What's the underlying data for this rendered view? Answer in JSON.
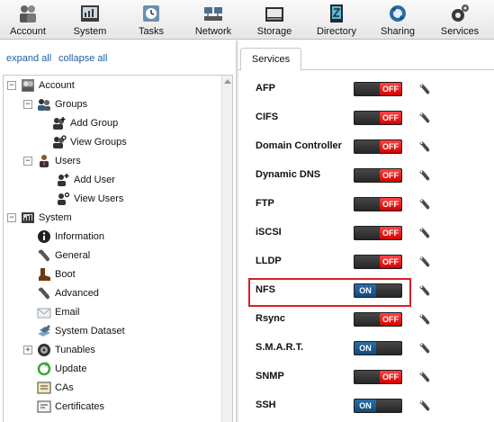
{
  "toolbar": {
    "items": [
      {
        "label": "Account",
        "icon": "account-icon"
      },
      {
        "label": "System",
        "icon": "system-icon"
      },
      {
        "label": "Tasks",
        "icon": "tasks-icon"
      },
      {
        "label": "Network",
        "icon": "network-icon"
      },
      {
        "label": "Storage",
        "icon": "storage-icon"
      },
      {
        "label": "Directory",
        "icon": "directory-icon"
      },
      {
        "label": "Sharing",
        "icon": "sharing-icon"
      },
      {
        "label": "Services",
        "icon": "services-icon"
      }
    ]
  },
  "left": {
    "expand_all": "expand all",
    "collapse_all": "collapse all",
    "tree": [
      {
        "label": "Account",
        "level": 0,
        "expander": "−",
        "icon": "account-group-icon"
      },
      {
        "label": "Groups",
        "level": 1,
        "expander": "−",
        "icon": "groups-icon"
      },
      {
        "label": "Add Group",
        "level": 2,
        "icon": "add-group-icon"
      },
      {
        "label": "View Groups",
        "level": 2,
        "icon": "view-groups-icon"
      },
      {
        "label": "Users",
        "level": 1,
        "expander": "−",
        "icon": "users-icon"
      },
      {
        "label": "Add User",
        "level": 2,
        "icon": "add-user-icon"
      },
      {
        "label": "View Users",
        "level": 2,
        "icon": "view-users-icon"
      },
      {
        "label": "System",
        "level": 0,
        "expander": "−",
        "icon": "system-icon"
      },
      {
        "label": "Information",
        "level": 1,
        "icon": "information-icon"
      },
      {
        "label": "General",
        "level": 1,
        "icon": "wrench-icon"
      },
      {
        "label": "Boot",
        "level": 1,
        "icon": "boot-icon"
      },
      {
        "label": "Advanced",
        "level": 1,
        "icon": "wrench-icon"
      },
      {
        "label": "Email",
        "level": 1,
        "icon": "email-icon"
      },
      {
        "label": "System Dataset",
        "level": 1,
        "icon": "system-dataset-icon"
      },
      {
        "label": "Tunables",
        "level": 1,
        "expander": "+",
        "icon": "tunables-icon"
      },
      {
        "label": "Update",
        "level": 1,
        "icon": "update-icon"
      },
      {
        "label": "CAs",
        "level": 1,
        "icon": "cas-icon"
      },
      {
        "label": "Certificates",
        "level": 1,
        "icon": "certificates-icon"
      }
    ]
  },
  "right": {
    "tab_label": "Services",
    "services": [
      {
        "name": "AFP",
        "state": "OFF"
      },
      {
        "name": "CIFS",
        "state": "OFF"
      },
      {
        "name": "Domain Controller",
        "state": "OFF"
      },
      {
        "name": "Dynamic DNS",
        "state": "OFF"
      },
      {
        "name": "FTP",
        "state": "OFF"
      },
      {
        "name": "iSCSI",
        "state": "OFF"
      },
      {
        "name": "LLDP",
        "state": "OFF"
      },
      {
        "name": "NFS",
        "state": "ON",
        "highlighted": true
      },
      {
        "name": "Rsync",
        "state": "OFF"
      },
      {
        "name": "S.M.A.R.T.",
        "state": "ON"
      },
      {
        "name": "SNMP",
        "state": "OFF"
      },
      {
        "name": "SSH",
        "state": "ON"
      }
    ]
  },
  "colors": {
    "on": "#14497a",
    "off": "#d40000",
    "highlight": "#d91f26",
    "link": "#1f5fa8"
  }
}
